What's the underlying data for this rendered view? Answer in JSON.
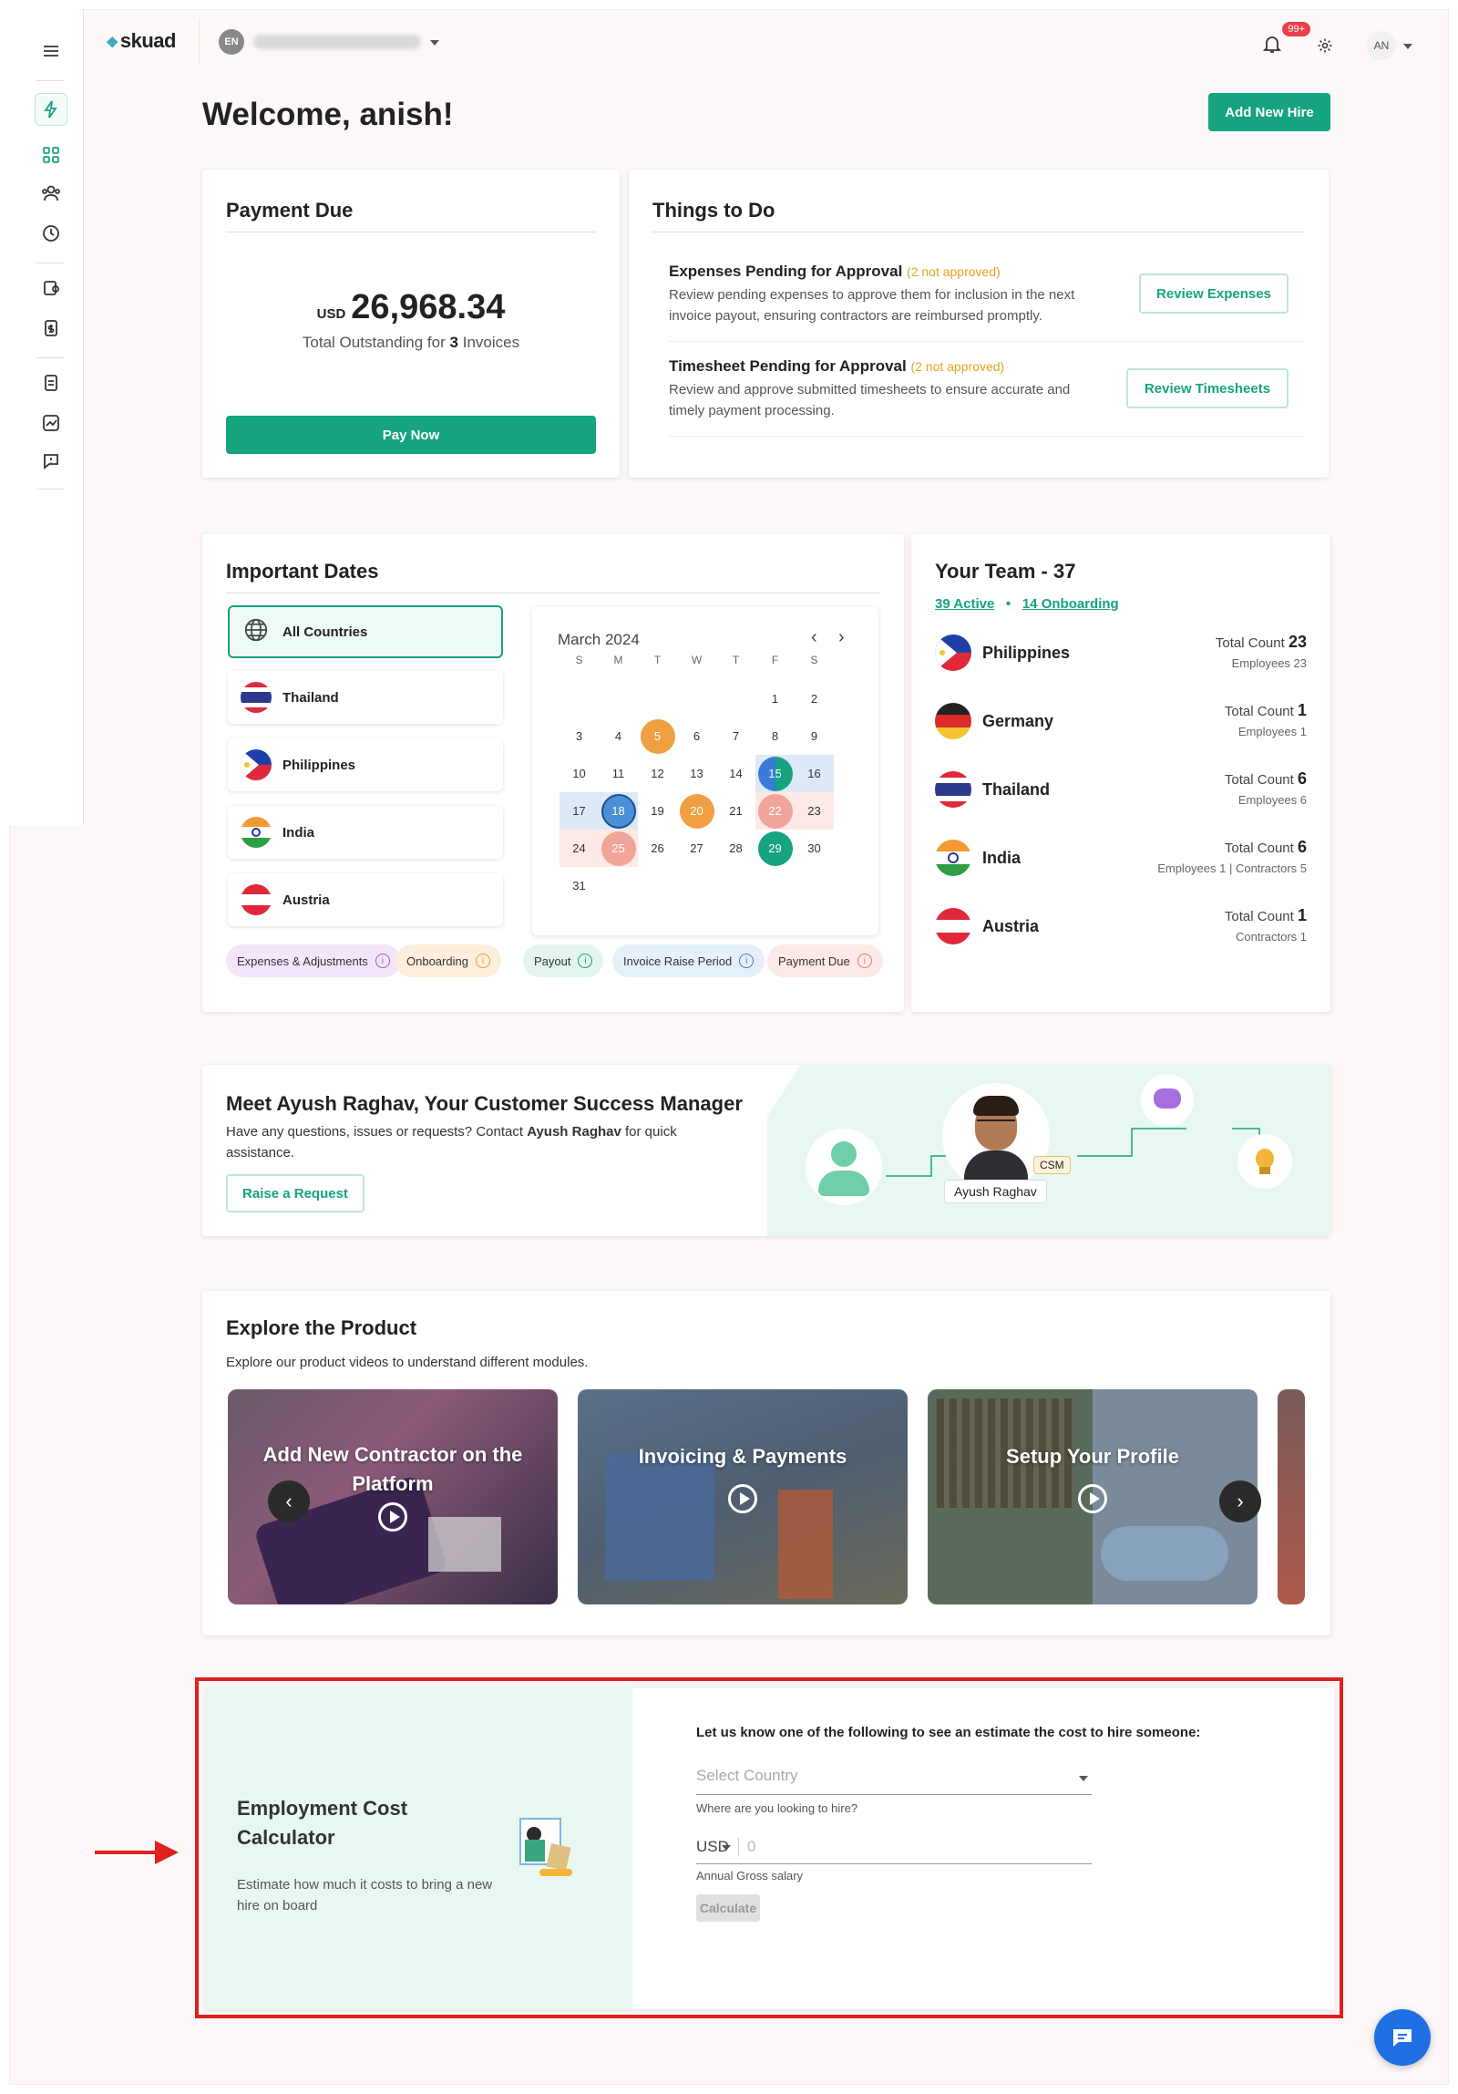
{
  "header": {
    "logo": "skuad",
    "lang": "EN",
    "notif_count": "99+",
    "avatar": "AN"
  },
  "welcome": "Welcome, anish!",
  "add_hire_button": "Add New Hire",
  "payment": {
    "title": "Payment Due",
    "currency": "USD",
    "amount": "26,968.34",
    "outstanding_prefix": "Total Outstanding for",
    "invoice_count": "3",
    "outstanding_suffix": "Invoices",
    "pay_button": "Pay Now"
  },
  "todo": {
    "title": "Things to Do",
    "items": [
      {
        "title": "Expenses Pending for Approval",
        "status": "(2 not approved)",
        "desc": "Review pending expenses to approve them for inclusion in the next invoice payout, ensuring contractors are reimbursed promptly.",
        "button": "Review Expenses"
      },
      {
        "title": "Timesheet Pending for Approval",
        "status": "(2 not approved)",
        "desc": "Review and approve submitted timesheets to ensure accurate and timely payment processing.",
        "button": "Review Timesheets"
      }
    ]
  },
  "dates": {
    "title": "Important Dates",
    "countries": [
      "All Countries",
      "Thailand",
      "Philippines",
      "India",
      "Austria"
    ],
    "calendar": {
      "month": "March 2024",
      "weekdays": [
        "S",
        "M",
        "T",
        "W",
        "T",
        "F",
        "S"
      ]
    },
    "legend": [
      "Expenses & Adjustments",
      "Onboarding",
      "Payout",
      "Invoice Raise Period",
      "Payment Due"
    ]
  },
  "team": {
    "title": "Your Team - 37",
    "active": "39 Active",
    "onboarding": "14 Onboarding",
    "total_label": "Total Count",
    "rows": [
      {
        "country": "Philippines",
        "total": "23",
        "detail": "Employees 23"
      },
      {
        "country": "Germany",
        "total": "1",
        "detail": "Employees 1"
      },
      {
        "country": "Thailand",
        "total": "6",
        "detail": "Employees 6"
      },
      {
        "country": "India",
        "total": "6",
        "detail": "Employees 1 | Contractors 5"
      },
      {
        "country": "Austria",
        "total": "1",
        "detail": "Contractors 1"
      }
    ]
  },
  "csm": {
    "title": "Meet Ayush Raghav, Your Customer Success Manager",
    "desc_prefix": "Have any questions, issues or requests? Contact",
    "name": "Ayush Raghav",
    "desc_suffix": "for quick assistance.",
    "button": "Raise a Request",
    "badge": "CSM"
  },
  "explore": {
    "title": "Explore the Product",
    "subtitle": "Explore our product videos to understand different modules.",
    "videos": [
      "Add New Contractor on the Platform",
      "Invoicing & Payments",
      "Setup Your Profile"
    ]
  },
  "calculator": {
    "title": "Employment Cost Calculator",
    "desc": "Estimate how much it costs to bring a new hire on board",
    "prompt": "Let us know one of the following to see an estimate the cost to hire someone:",
    "country_placeholder": "Select Country",
    "country_help": "Where are you looking to hire?",
    "currency": "USD",
    "salary_placeholder": "0",
    "salary_help": "Annual Gross salary",
    "button": "Calculate"
  },
  "colors": {
    "accent": "#16a37f",
    "warning": "#e8a220",
    "highlight": "#e02020"
  }
}
